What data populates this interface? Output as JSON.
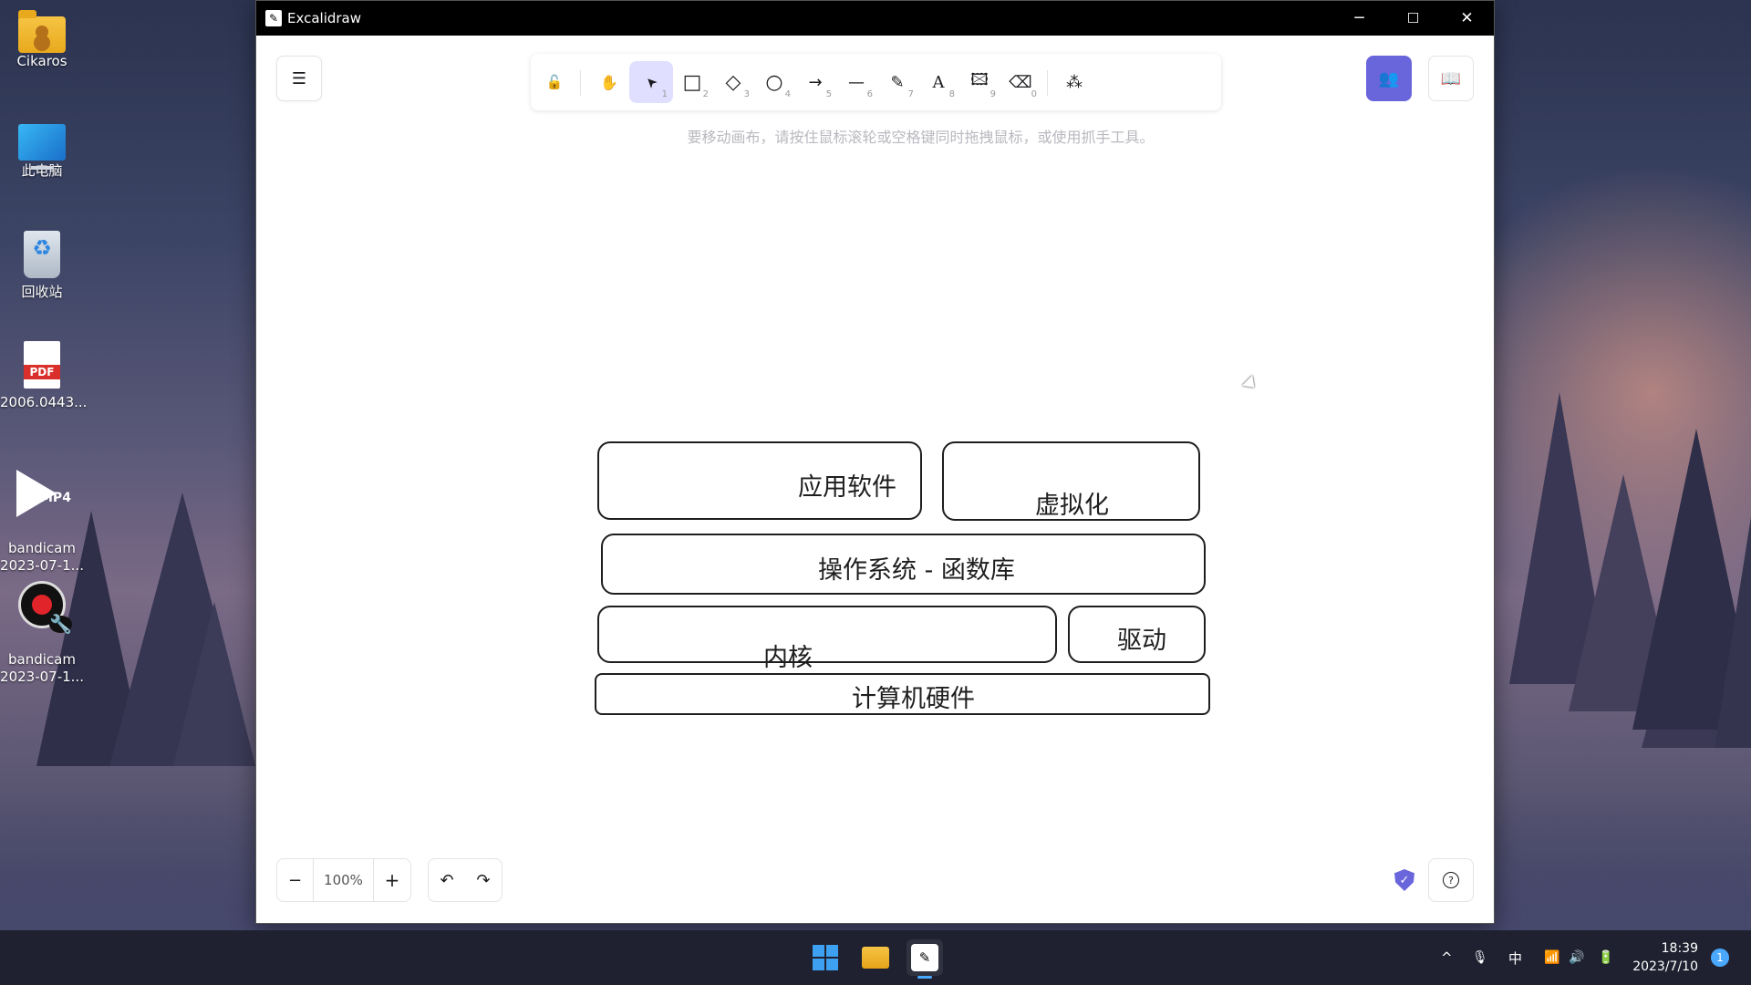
{
  "desktop": {
    "icons": [
      {
        "label": "Cikaros",
        "icon": "user-folder-icon"
      },
      {
        "label": "此电脑",
        "icon": "computer-icon"
      },
      {
        "label": "回收站",
        "icon": "recycle-bin-icon"
      },
      {
        "label": "2006.0443...",
        "icon": "pdf-file-icon",
        "badge": "PDF"
      },
      {
        "label": "bandicam\n2023-07-1...",
        "icon": "mp4-file-icon",
        "badge": "MP4"
      },
      {
        "label": "bandicam\n2023-07-1...",
        "icon": "bandicam-icon"
      }
    ]
  },
  "window": {
    "title": "Excalidraw",
    "controls": {
      "minimize": "─",
      "maximize": "☐",
      "close": "✕"
    }
  },
  "toolbar": {
    "tools": [
      {
        "name": "lock",
        "icon": "lock-icon",
        "glyph": "🔓",
        "key": ""
      },
      {
        "name": "hand",
        "icon": "hand-icon",
        "glyph": "✋",
        "key": ""
      },
      {
        "name": "selection",
        "icon": "pointer-icon",
        "glyph": "➤",
        "key": "1",
        "active": true
      },
      {
        "name": "rectangle",
        "icon": "rectangle-icon",
        "glyph": "□",
        "key": "2"
      },
      {
        "name": "diamond",
        "icon": "diamond-icon",
        "glyph": "◇",
        "key": "3"
      },
      {
        "name": "ellipse",
        "icon": "ellipse-icon",
        "glyph": "○",
        "key": "4"
      },
      {
        "name": "arrow",
        "icon": "arrow-icon",
        "glyph": "→",
        "key": "5"
      },
      {
        "name": "line",
        "icon": "line-icon",
        "glyph": "—",
        "key": "6"
      },
      {
        "name": "draw",
        "icon": "pencil-icon",
        "glyph": "✎",
        "key": "7"
      },
      {
        "name": "text",
        "icon": "text-icon",
        "glyph": "A",
        "key": "8"
      },
      {
        "name": "image",
        "icon": "image-icon",
        "glyph": "🖾",
        "key": "9"
      },
      {
        "name": "eraser",
        "icon": "eraser-icon",
        "glyph": "⌫",
        "key": "0"
      },
      {
        "name": "extra-tools",
        "icon": "shapes-icon",
        "glyph": "⁂",
        "key": ""
      }
    ]
  },
  "hint": "要移动画布，请按住鼠标滚轮或空格键同时拖拽鼠标，或使用抓手工具。",
  "diagram": {
    "app_software": "应用软件",
    "virtualization": "虚拟化",
    "os_lib": "操作系统 - 函数库",
    "kernel": "内核",
    "driver": "驱动",
    "hardware": "计算机硬件"
  },
  "footer": {
    "zoom_out": "−",
    "zoom": "100%",
    "zoom_in": "+",
    "undo": "↶",
    "redo": "↷",
    "help": "?"
  },
  "taskbar": {
    "tray": {
      "chevron": "^",
      "mic": "🎙",
      "ime": "中",
      "wifi": "📶",
      "volume": "🔊",
      "battery": "🔋"
    },
    "time": "18:39",
    "date": "2023/7/10",
    "notifications": "1"
  },
  "colors": {
    "accent": "#6965db",
    "selected_tool_bg": "#e0dfff"
  }
}
